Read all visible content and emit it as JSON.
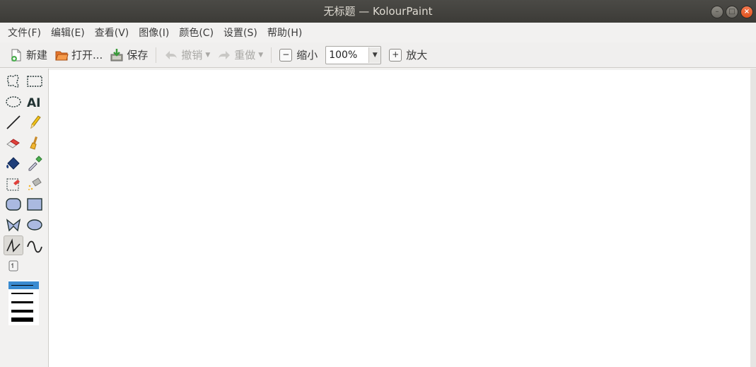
{
  "window": {
    "title": "无标题 — KolourPaint"
  },
  "menubar": {
    "items": [
      "文件(F)",
      "编辑(E)",
      "查看(V)",
      "图像(I)",
      "颜色(C)",
      "设置(S)",
      "帮助(H)"
    ]
  },
  "toolbar": {
    "new_label": "新建",
    "open_label": "打开...",
    "save_label": "保存",
    "undo_label": "撤销",
    "redo_label": "重做",
    "zoom_out_label": "缩小",
    "zoom_value": "100%",
    "zoom_in_label": "放大"
  },
  "tools": {
    "names": [
      "free-form-select",
      "rectangular-select",
      "elliptical-select",
      "text",
      "line",
      "pen",
      "eraser",
      "brush",
      "flood-fill",
      "color-picker",
      "color-eraser",
      "spraycan",
      "rounded-rectangle",
      "rectangle",
      "polygon",
      "ellipse",
      "polyline",
      "curve",
      "zoom"
    ],
    "active": "polyline"
  },
  "line_widths": {
    "selected_index": 0,
    "count": 4
  },
  "colors": {
    "accent": "#3a8bd1",
    "close": "#e95420"
  }
}
